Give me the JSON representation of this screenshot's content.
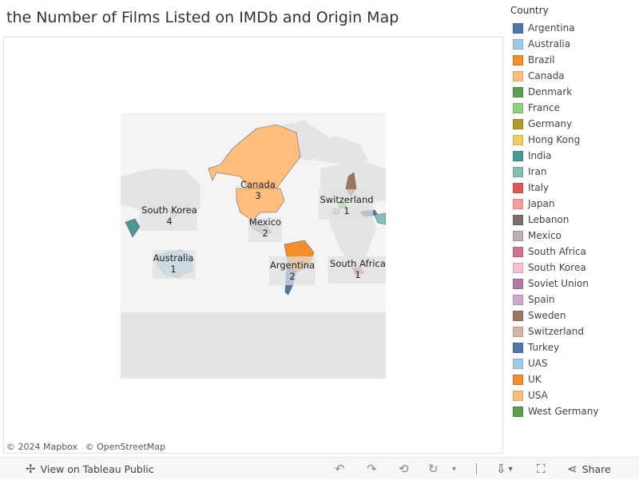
{
  "title": "the Number of Films Listed on IMDb and Origin Map",
  "legend": {
    "title": "Country",
    "items": [
      {
        "label": "Argentina",
        "color": "#4e79a7"
      },
      {
        "label": "Australia",
        "color": "#a0cbe8"
      },
      {
        "label": "Brazil",
        "color": "#f28e2b"
      },
      {
        "label": "Canada",
        "color": "#ffbe7d"
      },
      {
        "label": "Denmark",
        "color": "#59a14f"
      },
      {
        "label": "France",
        "color": "#8cd17d"
      },
      {
        "label": "Germany",
        "color": "#b6992d"
      },
      {
        "label": "Hong Kong",
        "color": "#f1ce63"
      },
      {
        "label": "India",
        "color": "#499894"
      },
      {
        "label": "Iran",
        "color": "#86bcb6"
      },
      {
        "label": "Italy",
        "color": "#e15759"
      },
      {
        "label": "Japan",
        "color": "#ff9d9a"
      },
      {
        "label": "Lebanon",
        "color": "#79706e"
      },
      {
        "label": "Mexico",
        "color": "#bab0ac"
      },
      {
        "label": "South Africa",
        "color": "#d37295"
      },
      {
        "label": "South Korea",
        "color": "#fabfd2"
      },
      {
        "label": "Soviet Union",
        "color": "#b07aa1"
      },
      {
        "label": "Spain",
        "color": "#d4a6c8"
      },
      {
        "label": "Sweden",
        "color": "#9d7660"
      },
      {
        "label": "Switzerland",
        "color": "#d7b5a6"
      },
      {
        "label": "Turkey",
        "color": "#4e79a7"
      },
      {
        "label": "UAS",
        "color": "#a0cbe8"
      },
      {
        "label": "UK",
        "color": "#f28e2b"
      },
      {
        "label": "USA",
        "color": "#ffbe7d"
      },
      {
        "label": "West Germany",
        "color": "#59a14f"
      }
    ]
  },
  "map_labels": [
    {
      "name": "Canada",
      "value": "3"
    },
    {
      "name": "Mexico",
      "value": "2"
    },
    {
      "name": "South Korea",
      "value": "4"
    },
    {
      "name": "Switzerland",
      "value": "1"
    },
    {
      "name": "Australia",
      "value": "1"
    },
    {
      "name": "Argentina",
      "value": "2"
    },
    {
      "name": "South Africa",
      "value": "1"
    }
  ],
  "attribution": [
    "© 2024 Mapbox",
    "© OpenStreetMap"
  ],
  "toolbar": {
    "view_label": "View on Tableau Public",
    "share_label": "Share",
    "icons": {
      "undo": "↶",
      "redo": "↷",
      "revert": "⟲",
      "refresh": "↻",
      "download": "⇩",
      "fullscreen": "⛶",
      "share": "⋖",
      "tableau": "✢",
      "caret": "▾"
    }
  }
}
